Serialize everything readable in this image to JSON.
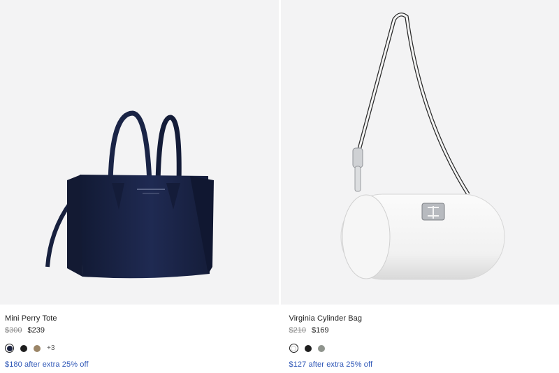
{
  "products": [
    {
      "name": "Mini Perry Tote",
      "price_original": "$300",
      "price_sale": "$239",
      "promo": "$180 after extra 25% off",
      "image_icon": "navy-tote-bag",
      "swatches": [
        {
          "color": "#1c2340",
          "selected": true
        },
        {
          "color": "#1e1e1e",
          "selected": false
        },
        {
          "color": "#9b8567",
          "selected": false
        }
      ],
      "more_colors": "+3"
    },
    {
      "name": "Virginia Cylinder Bag",
      "price_original": "$210",
      "price_sale": "$169",
      "promo": "$127 after extra 25% off",
      "image_icon": "white-cylinder-bag",
      "swatches": [
        {
          "color": "#ffffff",
          "selected": true
        },
        {
          "color": "#1e1e1e",
          "selected": false
        },
        {
          "color": "#8f948d",
          "selected": false
        }
      ]
    }
  ],
  "colors": {
    "promo": "#2f57b7",
    "image_bg": "#f3f3f4"
  }
}
